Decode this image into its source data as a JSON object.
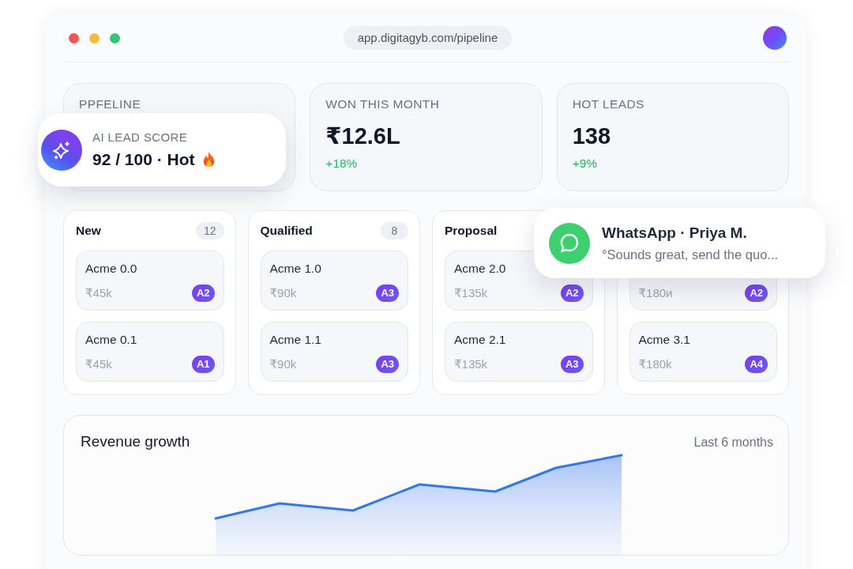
{
  "window": {
    "address": "app.digitagyb.com/pipeline"
  },
  "stats": [
    {
      "label": "PPFELINE"
    },
    {
      "label": "WON THIS MONTH",
      "value": "₹12.6L",
      "change": "+18%"
    },
    {
      "label": "HOT LEADS",
      "value": "138",
      "change": "+9%"
    }
  ],
  "lead_score_popup": {
    "label": "AI LEAD SCORE",
    "value": "92 / 100 · Hot"
  },
  "pipeline": {
    "columns": [
      {
        "title": "New",
        "count": "12",
        "deals": [
          {
            "name": "Acme 0.0",
            "amount": "₹45k",
            "grade": "A2"
          },
          {
            "name": "Acme 0.1",
            "amount": "₹45k",
            "grade": "A1"
          }
        ]
      },
      {
        "title": "Qualified",
        "count": "8",
        "deals": [
          {
            "name": "Acme 1.0",
            "amount": "₹90k",
            "grade": "A3"
          },
          {
            "name": "Acme 1.1",
            "amount": "₹90k",
            "grade": "A3"
          }
        ]
      },
      {
        "title": "Proposal",
        "deals": [
          {
            "name": "Acme 2.0",
            "amount": "₹135k",
            "grade": "A2"
          },
          {
            "name": "Acme 2.1",
            "amount": "₹135k",
            "grade": "A3"
          }
        ]
      },
      {
        "deals": [
          {
            "amount": "₹180и",
            "grade": "A2"
          },
          {
            "name": "Acme 3.1",
            "amount": "₹180k",
            "grade": "A4"
          }
        ]
      }
    ]
  },
  "whatsapp_popup": {
    "title": "WhatsApp · Priya M.",
    "message": "°Sounds great, send the quo..."
  },
  "revenue": {
    "title": "Revenue growth",
    "period": "Last 6 months"
  }
}
